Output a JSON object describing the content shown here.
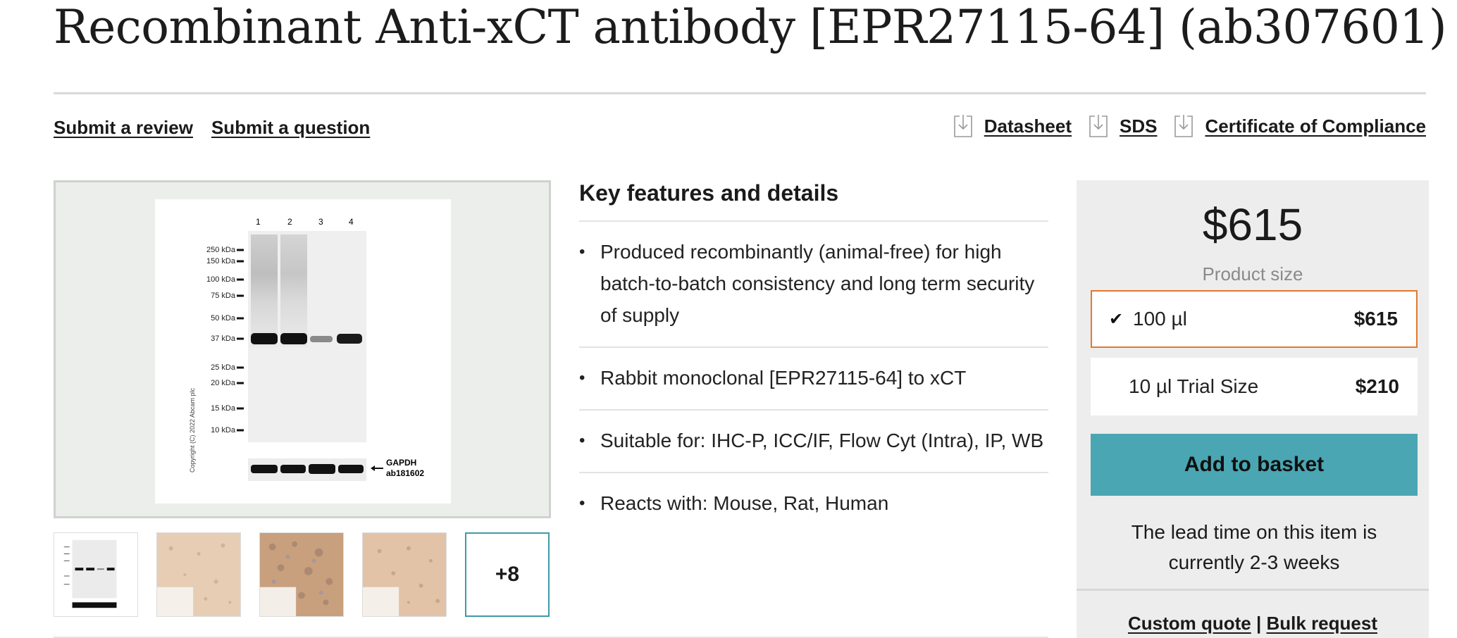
{
  "product": {
    "title": "Recombinant Anti-xCT antibody [EPR27115-64] (ab307601)"
  },
  "actions": {
    "submit_review": "Submit a review",
    "submit_question": "Submit a question"
  },
  "downloads": [
    {
      "label": "Datasheet",
      "icon": "download-icon"
    },
    {
      "label": "SDS",
      "icon": "download-icon"
    },
    {
      "label": "Certificate of Compliance",
      "icon": "download-icon"
    }
  ],
  "gallery": {
    "main_image": {
      "lanes": [
        "1",
        "2",
        "3",
        "4"
      ],
      "markers": [
        "250 kDa",
        "150 kDa",
        "100 kDa",
        "75 kDa",
        "50 kDa",
        "37 kDa",
        "25 kDa",
        "20 kDa",
        "15 kDa",
        "10 kDa"
      ],
      "loading_control": "GAPDH",
      "loading_control_id": "ab181602",
      "copyright": "Copyright (C) 2022 Abcam plc"
    },
    "more_label": "+8"
  },
  "features": {
    "heading": "Key features and details",
    "items": [
      "Produced recombinantly (animal-free) for high batch-to-batch consistency and long term security of supply",
      "Rabbit monoclonal [EPR27115-64] to xCT",
      "Suitable for: IHC-P, ICC/IF, Flow Cyt (Intra), IP, WB",
      "Reacts with: Mouse, Rat, Human"
    ]
  },
  "purchase": {
    "price": "$615",
    "size_label": "Product size",
    "options": [
      {
        "name": "100 µl",
        "price": "$615",
        "selected": true
      },
      {
        "name": "10 µl Trial Size",
        "price": "$210",
        "selected": false
      }
    ],
    "add_to_basket": "Add to basket",
    "lead_time": "The lead time on this item is currently 2-3 weeks",
    "custom_quote": "Custom quote",
    "separator": "|",
    "bulk_request": "Bulk request",
    "colors": {
      "selected_border": "#e07a2f",
      "button": "#4aa6b2"
    }
  }
}
